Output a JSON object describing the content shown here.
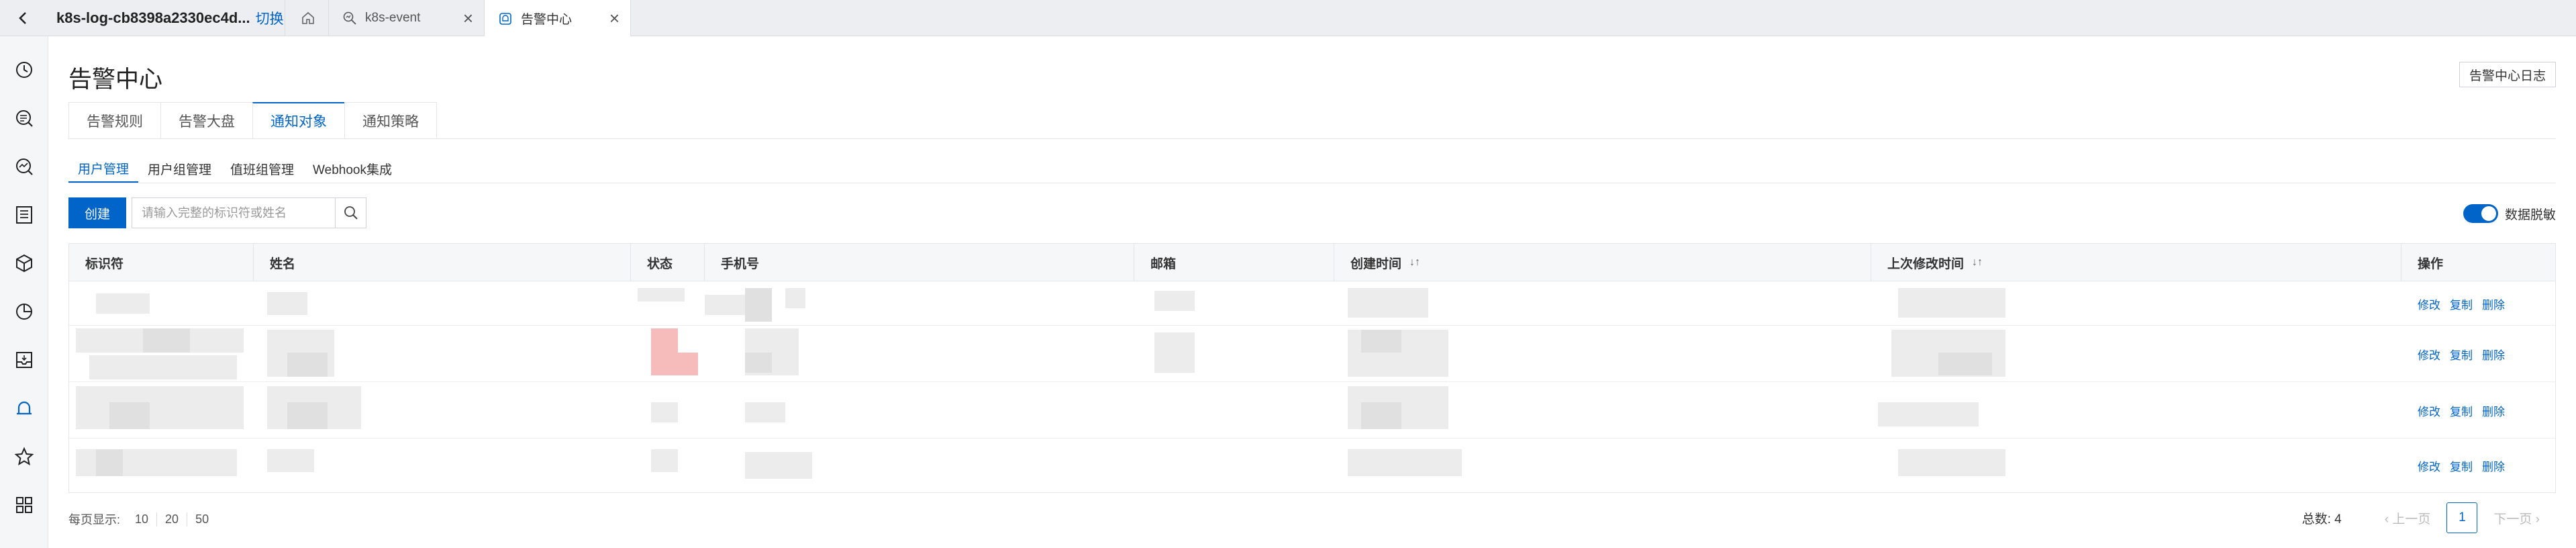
{
  "topbar": {
    "cluster_name": "k8s-log-cb8398a2330ec4d...",
    "switch_label": "切换",
    "tabs": [
      {
        "label": "k8s-event",
        "icon": "search-chart-icon"
      },
      {
        "label": "告警中心",
        "icon": "alert-center-icon"
      }
    ]
  },
  "sidebar": {
    "items": [
      "clock-icon",
      "search-list-icon",
      "search-chart-icon",
      "list-icon",
      "cube-icon",
      "pie-chart-icon",
      "inbox-icon",
      "bell-icon",
      "star-icon",
      "apps-icon"
    ],
    "active": "bell-icon"
  },
  "page": {
    "title": "告警中心",
    "log_button": "告警中心日志"
  },
  "tabs_primary": [
    "告警规则",
    "告警大盘",
    "通知对象",
    "通知策略"
  ],
  "tabs_primary_active": 2,
  "tabs_secondary": [
    "用户管理",
    "用户组管理",
    "值班组管理",
    "Webhook集成"
  ],
  "tabs_secondary_active": 0,
  "toolbar": {
    "create_label": "创建",
    "search_placeholder": "请输入完整的标识符或姓名",
    "mask_label": "数据脱敏",
    "mask_enabled": true
  },
  "table": {
    "headers": [
      "标识符",
      "姓名",
      "状态",
      "手机号",
      "邮箱",
      "创建时间",
      "上次修改时间",
      "操作"
    ],
    "sortable": [
      false,
      false,
      false,
      false,
      false,
      true,
      true,
      false
    ],
    "row_actions": [
      "修改",
      "复制",
      "删除"
    ],
    "row_count": 4
  },
  "footer": {
    "page_size_label": "每页显示:",
    "page_sizes": [
      "10",
      "20",
      "50"
    ],
    "total_label": "总数: 4",
    "prev_label": "上一页",
    "next_label": "下一页",
    "current_page": "1"
  },
  "colors": {
    "accent": "#0064c8",
    "background": "#f5f6f8"
  }
}
